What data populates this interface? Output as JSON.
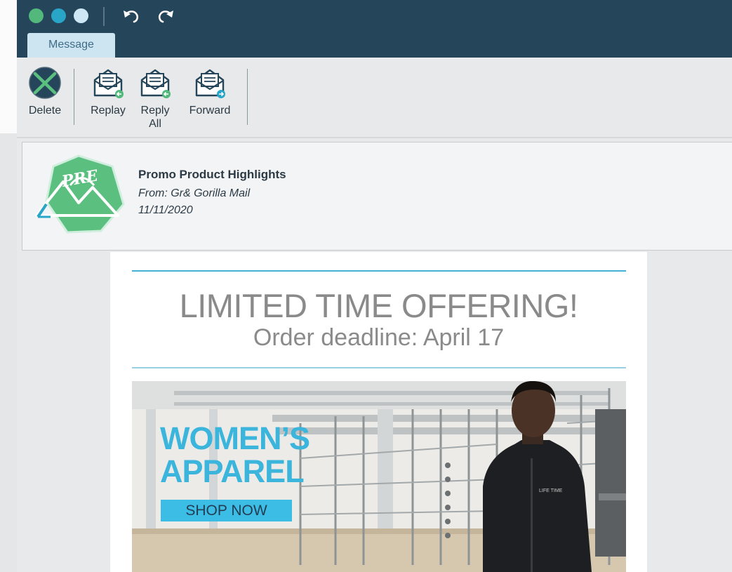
{
  "toolbar_tab": {
    "label": "Message"
  },
  "ribbon": {
    "delete_label": "Delete",
    "reply_label": "Replay",
    "reply_all_label": "Reply All",
    "forward_label": "Forward"
  },
  "message": {
    "subject": "Promo Product Highlights",
    "from": "From: Gr& Gorilla Mail",
    "date": "11/11/2020",
    "logo_text": "PRE"
  },
  "email_body": {
    "headline": "LIMITED TIME OFFERING!",
    "subheadline": "Order deadline: April 17",
    "banner_title_line1": "WOMEN’S",
    "banner_title_line2": "APPAREL",
    "shop_button": "SHOP NOW",
    "jacket_brand": "LIFE TIME"
  },
  "colors": {
    "titlebar": "#24455a",
    "window_dot_green": "#52b87c",
    "window_dot_teal": "#29a6c7",
    "window_dot_light": "#cde7f4",
    "accent_blue": "#3bb5dc",
    "logo_green": "#5bbf7f"
  },
  "icons": [
    "undo-icon",
    "redo-icon",
    "delete-icon",
    "reply-icon",
    "reply-all-icon",
    "forward-icon"
  ]
}
